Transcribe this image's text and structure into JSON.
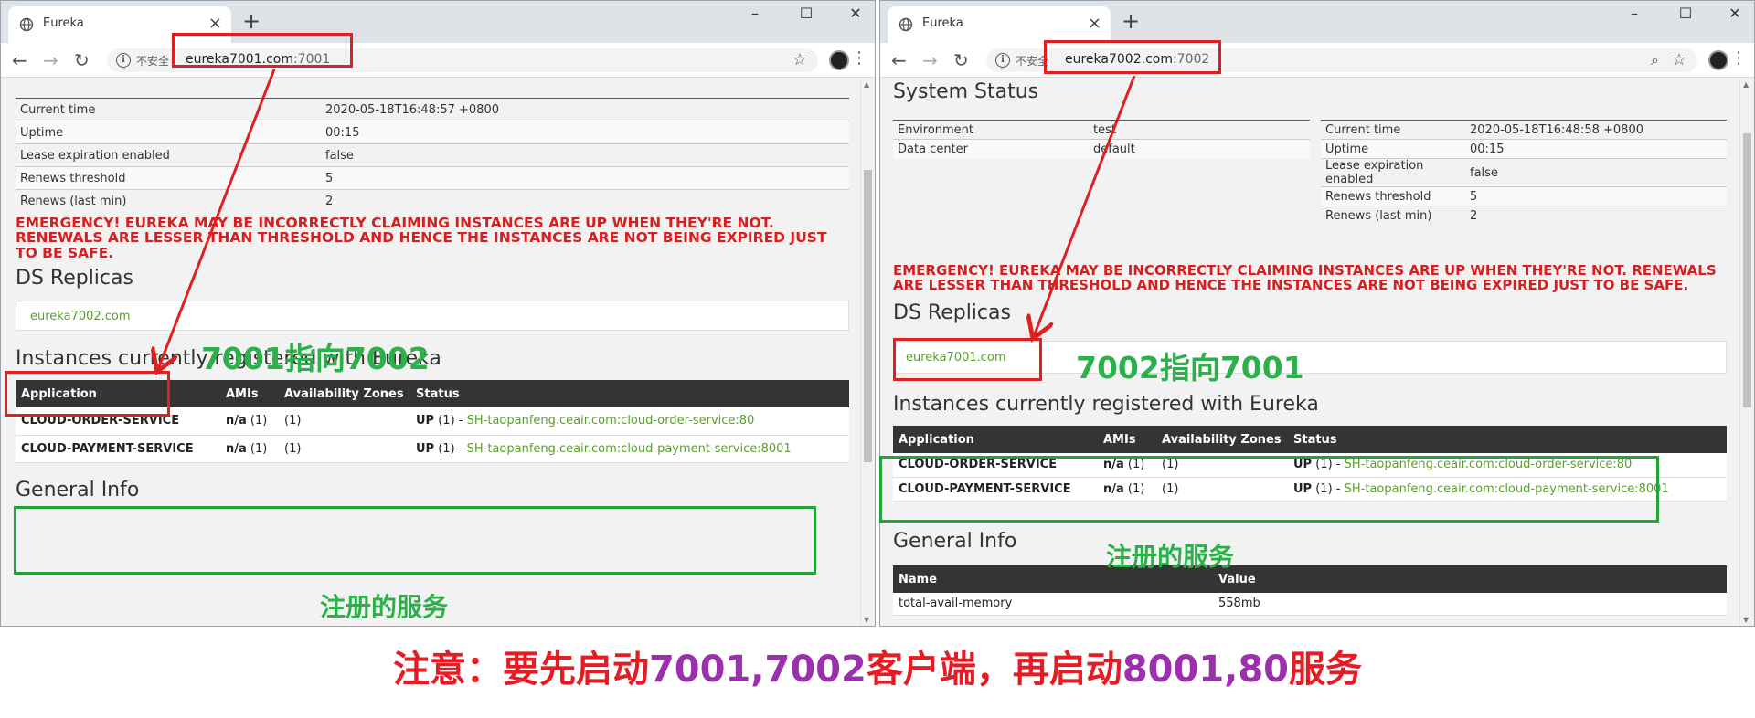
{
  "left": {
    "tab_title": "Eureka",
    "insecure_label": "不安全",
    "url_host": "eureka7001.com",
    "url_port": ":7001",
    "status_rows": [
      {
        "label": "Current time",
        "value": "2020-05-18T16:48:57 +0800"
      },
      {
        "label": "Uptime",
        "value": "00:15"
      },
      {
        "label": "Lease expiration enabled",
        "value": "false"
      },
      {
        "label": "Renews threshold",
        "value": "5"
      },
      {
        "label": "Renews (last min)",
        "value": "2"
      }
    ],
    "emergency": "EMERGENCY! EUREKA MAY BE INCORRECTLY CLAIMING INSTANCES ARE UP WHEN THEY'RE NOT. RENEWALS ARE LESSER THAN THRESHOLD AND HENCE THE INSTANCES ARE NOT BEING EXPIRED JUST TO BE SAFE.",
    "ds_replicas_heading": "DS Replicas",
    "replica": "eureka7002.com",
    "instances_heading": "Instances currently registered with Eureka",
    "instances_headers": [
      "Application",
      "AMIs",
      "Availability Zones",
      "Status"
    ],
    "instances": [
      {
        "app": "CLOUD-ORDER-SERVICE",
        "amis": "n/a",
        "amis_count": "(1)",
        "zones": "(1)",
        "status": "UP",
        "status_count": "(1) -",
        "instance": "SH-taopanfeng.ceair.com:cloud-order-service:80"
      },
      {
        "app": "CLOUD-PAYMENT-SERVICE",
        "amis": "n/a",
        "amis_count": "(1)",
        "zones": "(1)",
        "status": "UP",
        "status_count": "(1) -",
        "instance": "SH-taopanfeng.ceair.com:cloud-payment-service:8001"
      }
    ],
    "general_info_heading": "General Info",
    "annot_replica": "7001指向7002",
    "annot_services": "注册的服务"
  },
  "right": {
    "tab_title": "Eureka",
    "insecure_label": "不安全",
    "url_host": "eureka7002.com",
    "url_port": ":7002",
    "system_status_heading": "System Status",
    "env_rows": [
      {
        "label": "Environment",
        "value": "test"
      },
      {
        "label": "Data center",
        "value": "default"
      }
    ],
    "status_rows": [
      {
        "label": "Current time",
        "value": "2020-05-18T16:48:58 +0800"
      },
      {
        "label": "Uptime",
        "value": "00:15"
      },
      {
        "label": "Lease expiration enabled",
        "value": "false"
      },
      {
        "label": "Renews threshold",
        "value": "5"
      },
      {
        "label": "Renews (last min)",
        "value": "2"
      }
    ],
    "emergency": "EMERGENCY! EUREKA MAY BE INCORRECTLY CLAIMING INSTANCES ARE UP WHEN THEY'RE NOT. RENEWALS ARE LESSER THAN THRESHOLD AND HENCE THE INSTANCES ARE NOT BEING EXPIRED JUST TO BE SAFE.",
    "ds_replicas_heading": "DS Replicas",
    "replica": "eureka7001.com",
    "instances_heading": "Instances currently registered with Eureka",
    "instances_headers": [
      "Application",
      "AMIs",
      "Availability Zones",
      "Status"
    ],
    "instances": [
      {
        "app": "CLOUD-ORDER-SERVICE",
        "amis": "n/a",
        "amis_count": "(1)",
        "zones": "(1)",
        "status": "UP",
        "status_count": "(1) -",
        "instance": "SH-taopanfeng.ceair.com:cloud-order-service:80"
      },
      {
        "app": "CLOUD-PAYMENT-SERVICE",
        "amis": "n/a",
        "amis_count": "(1)",
        "zones": "(1)",
        "status": "UP",
        "status_count": "(1) -",
        "instance": "SH-taopanfeng.ceair.com:cloud-payment-service:8001"
      }
    ],
    "general_info_heading": "General Info",
    "general_headers": [
      "Name",
      "Value"
    ],
    "general_rows": [
      {
        "name": "total-avail-memory",
        "value": "558mb"
      }
    ],
    "annot_replica": "7002指向7001",
    "annot_services": "注册的服务"
  },
  "footnote": {
    "part1": "注意：要先启动",
    "part2": "7001,7002",
    "part3": "客户端，再启动",
    "part4": "8001,80",
    "part5": "服务"
  },
  "colors": {
    "emergency_red": "#d42020",
    "annotation_green": "#2bb04a",
    "highlight_red": "#e02020",
    "highlight_green": "#22a33a",
    "footnote_red": "#e51c23",
    "footnote_purple": "#9b2fae",
    "table_header_dark": "#363432",
    "link_green": "#5aa02c"
  }
}
